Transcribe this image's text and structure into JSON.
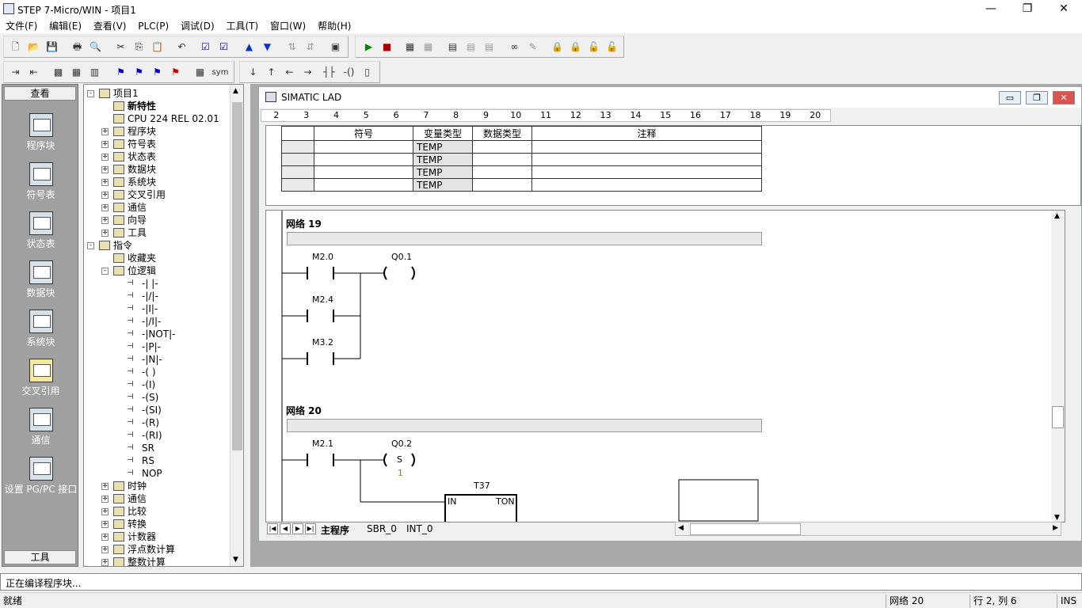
{
  "window": {
    "title": "STEP 7-Micro/WIN - 项目1"
  },
  "menu": [
    "文件(F)",
    "编辑(E)",
    "查看(V)",
    "PLC(P)",
    "调试(D)",
    "工具(T)",
    "窗口(W)",
    "帮助(H)"
  ],
  "toolbar2": {
    "sym_label": "sym"
  },
  "leftbar": {
    "header": "查看",
    "footer": "工具",
    "items": [
      "程序块",
      "符号表",
      "状态表",
      "数据块",
      "系统块",
      "交叉引用",
      "通信",
      "设置 PG/PC 接口"
    ]
  },
  "tree": {
    "rows": [
      {
        "label": "项目1",
        "exp": "-"
      },
      {
        "label": "新特性",
        "exp": ""
      },
      {
        "label": "CPU 224 REL 02.01",
        "exp": ""
      },
      {
        "label": "程序块",
        "exp": "+"
      },
      {
        "label": "符号表",
        "exp": "+"
      },
      {
        "label": "状态表",
        "exp": "+"
      },
      {
        "label": "数据块",
        "exp": "+"
      },
      {
        "label": "系统块",
        "exp": "+"
      },
      {
        "label": "交叉引用",
        "exp": "+"
      },
      {
        "label": "通信",
        "exp": "+"
      },
      {
        "label": "向导",
        "exp": "+"
      },
      {
        "label": "工具",
        "exp": "+"
      },
      {
        "label": "指令",
        "exp": "-"
      },
      {
        "label": "收藏夹",
        "exp": ""
      },
      {
        "label": "位逻辑",
        "exp": "-"
      },
      {
        "label": "-| |-",
        "exp": ""
      },
      {
        "label": "-|/|-",
        "exp": ""
      },
      {
        "label": "-|I|-",
        "exp": ""
      },
      {
        "label": "-|/I|-",
        "exp": ""
      },
      {
        "label": "-|NOT|-",
        "exp": ""
      },
      {
        "label": "-|P|-",
        "exp": ""
      },
      {
        "label": "-|N|-",
        "exp": ""
      },
      {
        "label": "-( )",
        "exp": ""
      },
      {
        "label": "-(I)",
        "exp": ""
      },
      {
        "label": "-(S)",
        "exp": ""
      },
      {
        "label": "-(SI)",
        "exp": ""
      },
      {
        "label": "-(R)",
        "exp": ""
      },
      {
        "label": "-(RI)",
        "exp": ""
      },
      {
        "label": "SR",
        "exp": ""
      },
      {
        "label": "RS",
        "exp": ""
      },
      {
        "label": "NOP",
        "exp": ""
      },
      {
        "label": "时钟",
        "exp": "+"
      },
      {
        "label": "通信",
        "exp": "+"
      },
      {
        "label": "比较",
        "exp": "+"
      },
      {
        "label": "转换",
        "exp": "+"
      },
      {
        "label": "计数器",
        "exp": "+"
      },
      {
        "label": "浮点数计算",
        "exp": "+"
      },
      {
        "label": "整数计算",
        "exp": "+"
      }
    ]
  },
  "editor": {
    "title": "SIMATIC LAD",
    "ruler": [
      "2",
      "3",
      "4",
      "5",
      "6",
      "7",
      "8",
      "9",
      "10",
      "11",
      "12",
      "13",
      "14",
      "15",
      "16",
      "17",
      "18",
      "19",
      "20"
    ],
    "var_table": {
      "headers": [
        "",
        "符号",
        "变量类型",
        "数据类型",
        "注释"
      ],
      "rows": [
        [
          "",
          "",
          "TEMP",
          "",
          ""
        ],
        [
          "",
          "",
          "TEMP",
          "",
          ""
        ],
        [
          "",
          "",
          "TEMP",
          "",
          ""
        ],
        [
          "",
          "",
          "TEMP",
          "",
          ""
        ]
      ]
    },
    "networks": [
      {
        "label": "网络 19",
        "contacts": [
          "M2.0",
          "M2.4",
          "M3.2"
        ],
        "coil": "Q0.1",
        "coil_type": ""
      },
      {
        "label": "网络 20",
        "contacts": [
          "M2.1"
        ],
        "coil": "Q0.2",
        "coil_type": "S",
        "coil_param": "1",
        "timer": "T37",
        "timer_in": "IN",
        "timer_type": "TON"
      }
    ],
    "tabs": [
      "主程序",
      "SBR_0",
      "INT_0"
    ]
  },
  "output": {
    "text": "正在编译程序块..."
  },
  "status": {
    "ready": "就绪",
    "network": "网络 20",
    "position": "行 2, 列 6",
    "mode": "INS"
  }
}
